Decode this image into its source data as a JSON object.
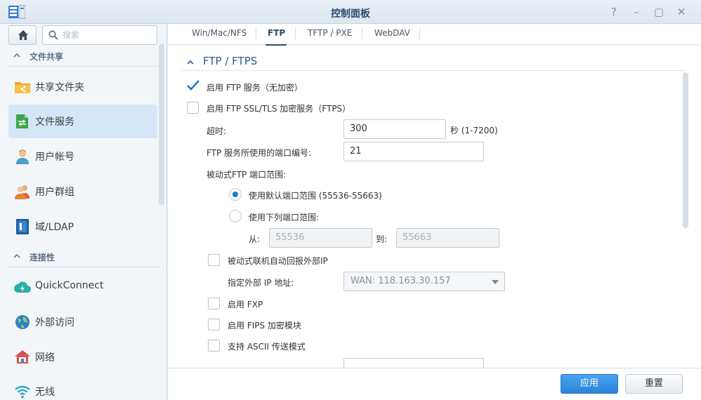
{
  "window": {
    "title": "控制面板",
    "controls": {
      "help": "?",
      "minimize": "–",
      "maximize": "▢",
      "close": "✕"
    }
  },
  "sidebar": {
    "search_placeholder": "搜索",
    "sections": [
      {
        "label": "文件共享"
      },
      {
        "label": "连接性"
      }
    ],
    "items": [
      {
        "label": "共享文件夹",
        "icon": "shared-folder-icon"
      },
      {
        "label": "文件服务",
        "icon": "file-services-icon",
        "active": true
      },
      {
        "label": "用户帐号",
        "icon": "user-icon"
      },
      {
        "label": "用户群组",
        "icon": "group-icon"
      },
      {
        "label": "域/LDAP",
        "icon": "domain-ldap-icon"
      },
      {
        "label": "QuickConnect",
        "icon": "quickconnect-icon"
      },
      {
        "label": "外部访问",
        "icon": "external-access-icon"
      },
      {
        "label": "网络",
        "icon": "network-icon"
      },
      {
        "label": "无线",
        "icon": "wireless-icon"
      }
    ]
  },
  "tabs": [
    {
      "label": "Win/Mac/NFS"
    },
    {
      "label": "FTP",
      "active": true
    },
    {
      "label": "TFTP / PXE"
    },
    {
      "label": "WebDAV"
    }
  ],
  "ftp": {
    "group_title": "FTP / FTPS",
    "enable_ftp": {
      "label": "启用 FTP 服务（无加密）",
      "checked": true
    },
    "enable_ftps": {
      "label": "启用 FTP SSL/TLS 加密服务（FTPS）",
      "checked": false
    },
    "timeout": {
      "label": "超时:",
      "value": "300",
      "suffix": "秒 (1-7200)"
    },
    "port": {
      "label": "FTP 服务所使用的端口编号:",
      "value": "21"
    },
    "passive_range_label": "被动式FTP 端口范围:",
    "use_default_range": {
      "label": "使用默认端口范围 (55536-55663)",
      "selected": true
    },
    "use_custom_range": {
      "label": "使用下列端口范围:",
      "selected": false
    },
    "from_label": "从:",
    "from_value": "55536",
    "to_label": "到:",
    "to_value": "55663",
    "report_external_ip": {
      "label": "被动式联机自动回报外部IP",
      "checked": false
    },
    "external_ip": {
      "label": "指定外部 IP 地址:",
      "value": "WAN: 118.163.30.157"
    },
    "enable_fxp": {
      "label": "启用 FXP",
      "checked": false
    },
    "enable_fips": {
      "label": "启用 FIPS 加密模块",
      "checked": false
    },
    "ascii_mode": {
      "label": "支持 ASCII 传送模式",
      "checked": false
    }
  },
  "footer": {
    "apply_label": "应用",
    "reset_label": "重置"
  },
  "colors": {
    "accent": "#2b84d8",
    "active_item_bg": "#d4e6f7",
    "title_text": "#2d4a6c"
  }
}
